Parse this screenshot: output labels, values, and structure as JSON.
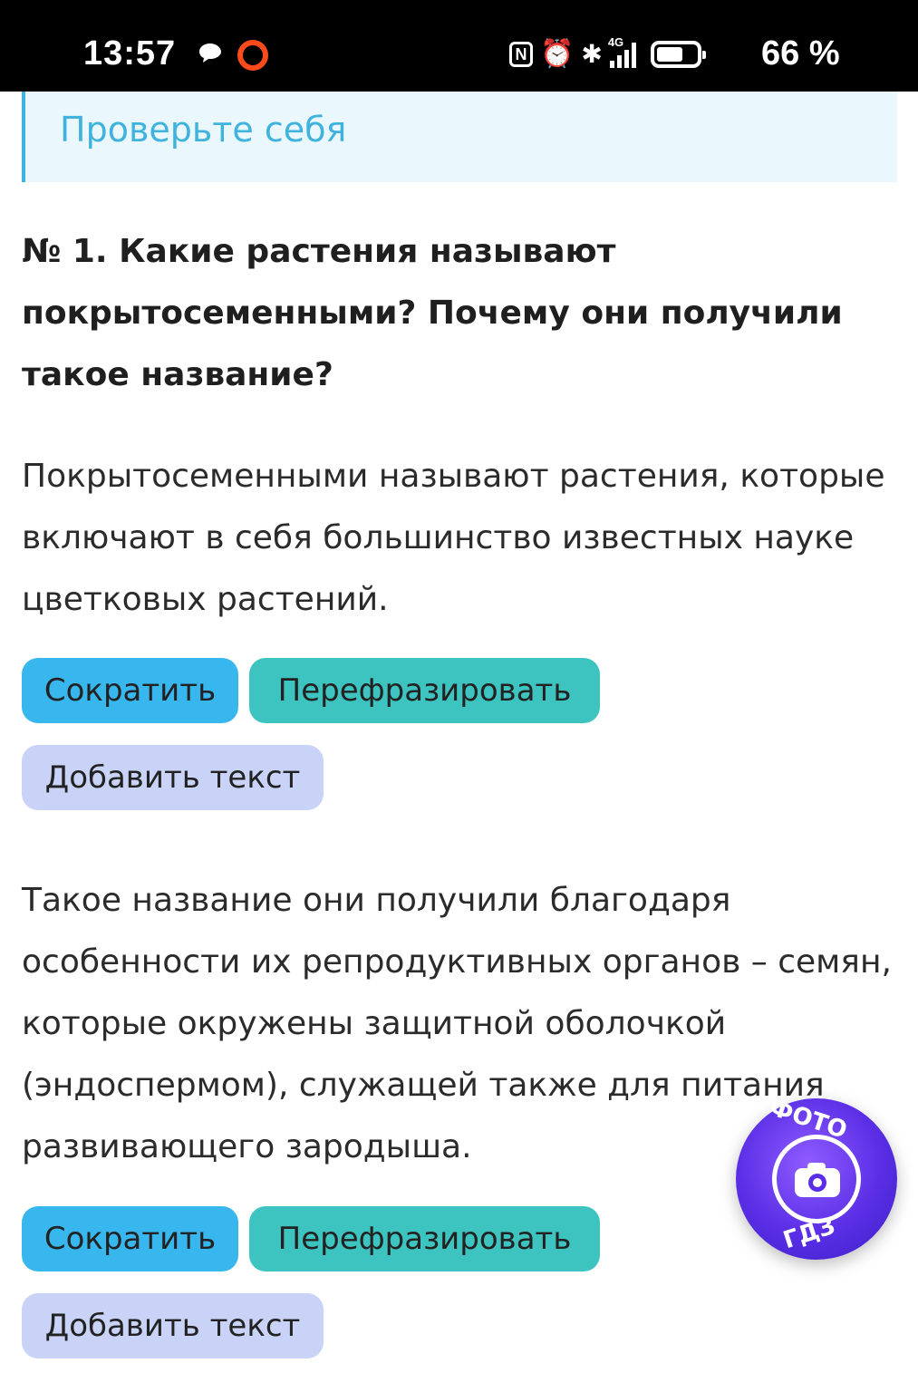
{
  "status_bar": {
    "time": "13:57",
    "nfc_label": "N",
    "network_label": "4G",
    "battery_percent": "66 %",
    "battery_level": 0.66,
    "icons": [
      "chat-bubble-icon",
      "recording-dot-icon",
      "nfc-icon",
      "alarm-icon",
      "bluetooth-icon",
      "signal-icon",
      "battery-icon"
    ]
  },
  "banner": {
    "title": "Проверьте себя"
  },
  "question": {
    "text": "№ 1. Какие растения называют покрытосеменными? Почему они получили такое название?"
  },
  "answers": [
    {
      "text": "Покрытосеменными называют растения, которые включают в себя большинство известных науке цветковых растений.",
      "shorten_label": "Сократить",
      "rephrase_label": "Перефразировать",
      "add_text_label": "Добавить текст"
    },
    {
      "text": "Такое название они получили благодаря особенности их репродуктивных органов – семян, которые окружены защитной оболочкой (эндоспермом), служащей также для питания развивающего зародыша.",
      "shorten_label": "Сократить",
      "rephrase_label": "Перефразировать",
      "add_text_label": "Добавить текст"
    }
  ],
  "photo_button": {
    "top_text": "ФОТО",
    "bottom_text": "ГДЗ",
    "icon": "camera-icon"
  },
  "colors": {
    "banner_accent": "#3fb3de",
    "banner_bg": "#eaf8fd",
    "shorten_bg": "#38b6ee",
    "rephrase_bg": "#3dc4c0",
    "add_text_bg": "#c8d3f7",
    "fab_bg": "#5a2ee6",
    "recording_dot": "#ff4a1c"
  }
}
